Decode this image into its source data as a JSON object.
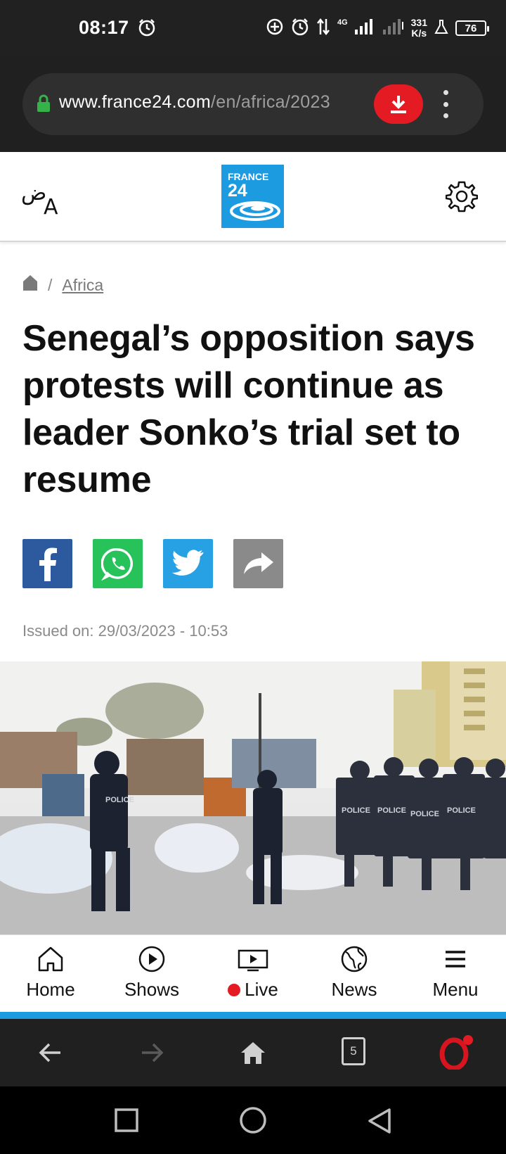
{
  "status_bar": {
    "time": "08:17",
    "net_type": "4G",
    "net_speed_value": "331",
    "net_speed_unit": "K/s",
    "battery": "76"
  },
  "browser": {
    "url_host": "www.france24.com",
    "url_path": "/en/africa/2023",
    "tab_count": "5"
  },
  "header": {
    "lang_icon_text": "ض A",
    "logo_line1": "FRANCE",
    "logo_line2": "24"
  },
  "breadcrumb": {
    "separator": "/",
    "section": "Africa"
  },
  "article": {
    "title": "Senegal’s opposition says protests will continue as leader Sonko’s trial set to resume",
    "issued": "Issued on: 29/03/2023 - 10:53"
  },
  "share": [
    "facebook-icon",
    "whatsapp-icon",
    "twitter-icon",
    "share-icon"
  ],
  "site_nav": {
    "items": [
      {
        "label": "Home",
        "icon": "home-icon"
      },
      {
        "label": "Shows",
        "icon": "play-icon"
      },
      {
        "label": "Live",
        "icon": "tv-icon"
      },
      {
        "label": "News",
        "icon": "globe-icon"
      },
      {
        "label": "Menu",
        "icon": "menu-icon"
      }
    ]
  },
  "colors": {
    "brand_blue": "#1d9be0",
    "live_red": "#e51b23",
    "facebook": "#2d5a9e",
    "whatsapp": "#27c25a",
    "twitter": "#27a1e4"
  }
}
